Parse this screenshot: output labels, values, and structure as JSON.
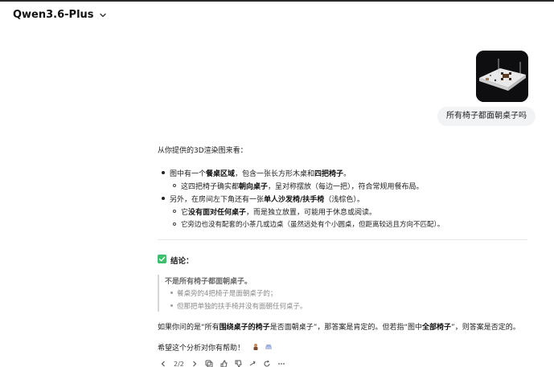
{
  "header": {
    "model_name": "Qwen3.6-Plus",
    "chevron_icon": "chevron-down-icon"
  },
  "user_message": {
    "image_icon": "3d-render-thumbnail",
    "text": "所有椅子都面朝桌子吗"
  },
  "answer": {
    "intro": "从你提供的3D渲染图来看：",
    "bullet1": {
      "pre": "图中有一个",
      "b1": "餐桌区域",
      "mid": "，包含一张长方形木桌和",
      "b2": "四把椅子",
      "post": "。"
    },
    "sub1": {
      "pre": "这四把椅子确实都",
      "b1": "朝向桌子",
      "post": "，呈对称摆放（每边一把），符合常规用餐布局。"
    },
    "bullet2": {
      "pre": "另外，在房间左下角还有一张",
      "b1": "单人沙发椅/扶手椅",
      "post": "（浅棕色）。"
    },
    "sub2": {
      "pre": "它",
      "b1": "没有面对任何桌子",
      "post": "，而是独立放置，可能用于休息或阅读。"
    },
    "sub3": {
      "text": "它旁边也没有配套的小茶几或边桌（虽然远处有个小圆桌，但距离较远且方向不匹配）。"
    },
    "conclusion_icon": "check-box-icon",
    "conclusion_title": "结论：",
    "quote": {
      "main": "不是所有椅子都面朝桌子。",
      "items": [
        "餐桌旁的4把椅子是面朝桌子的；",
        "但那把单独的扶手椅并没有面朝任何桌子。"
      ]
    },
    "final": {
      "pre": "如果你问的是“所有",
      "b1": "围绕桌子的椅子",
      "mid": "是否面朝桌子”，那答案是肯定的。但若指“图中",
      "b2": "全部椅子",
      "post": "”，则答案是否定的。"
    },
    "thanks": "希望这个分析对你有帮助！"
  },
  "toolbar": {
    "pager": "2/2",
    "icons": [
      "chevron-left-icon",
      "chevron-right-icon",
      "copy-icon",
      "thumbs-up-icon",
      "thumbs-down-icon",
      "share-icon",
      "refresh-icon",
      "more-icon"
    ]
  }
}
